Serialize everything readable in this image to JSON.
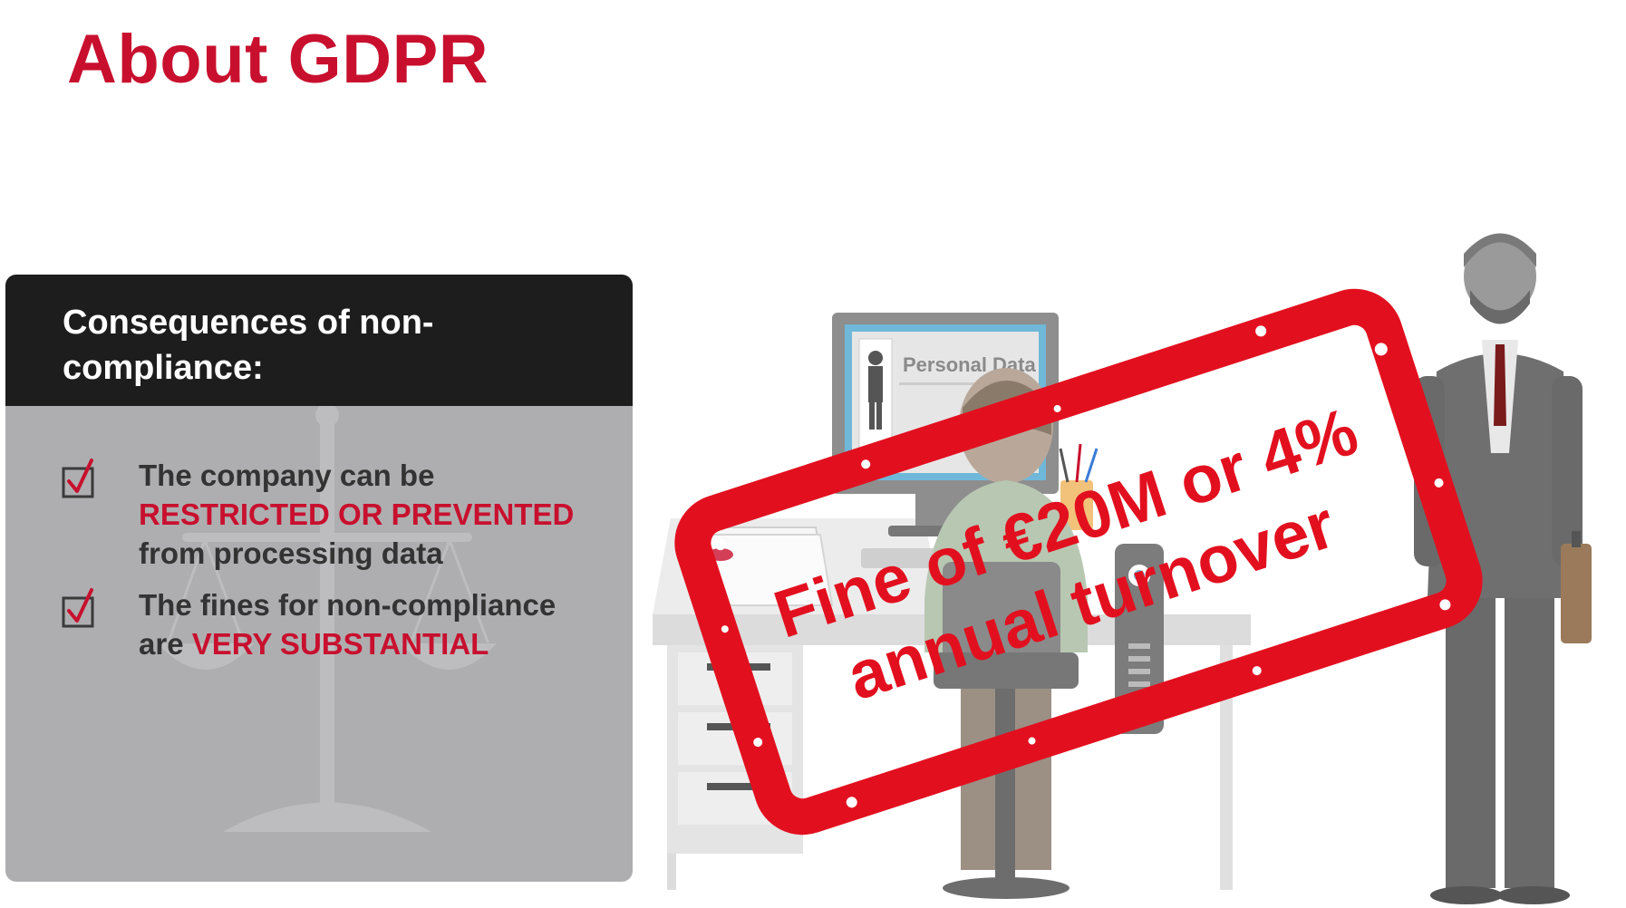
{
  "page": {
    "title": "About GDPR"
  },
  "panel": {
    "heading": "Consequences of non-compliance:",
    "items": [
      {
        "text_before": "The company can be ",
        "highlight": "RESTRICTED OR PREVENTED",
        "text_after": " from processing data"
      },
      {
        "text_before": "The fines for non-compliance are ",
        "highlight": "VERY SUBSTANTIAL",
        "text_after": ""
      }
    ]
  },
  "illustration": {
    "screen_label": "Personal Data",
    "stamp_line1": "Fine of €20M or 4%",
    "stamp_line2": "annual turnover"
  },
  "colors": {
    "brand_red": "#c8102e",
    "stamp_red": "#e2101f",
    "panel_header": "#1d1d1d",
    "panel_body": "#aeaeb0"
  },
  "icons": {
    "checkbox": "checked-box-icon",
    "watermark": "scales-of-justice-icon"
  }
}
